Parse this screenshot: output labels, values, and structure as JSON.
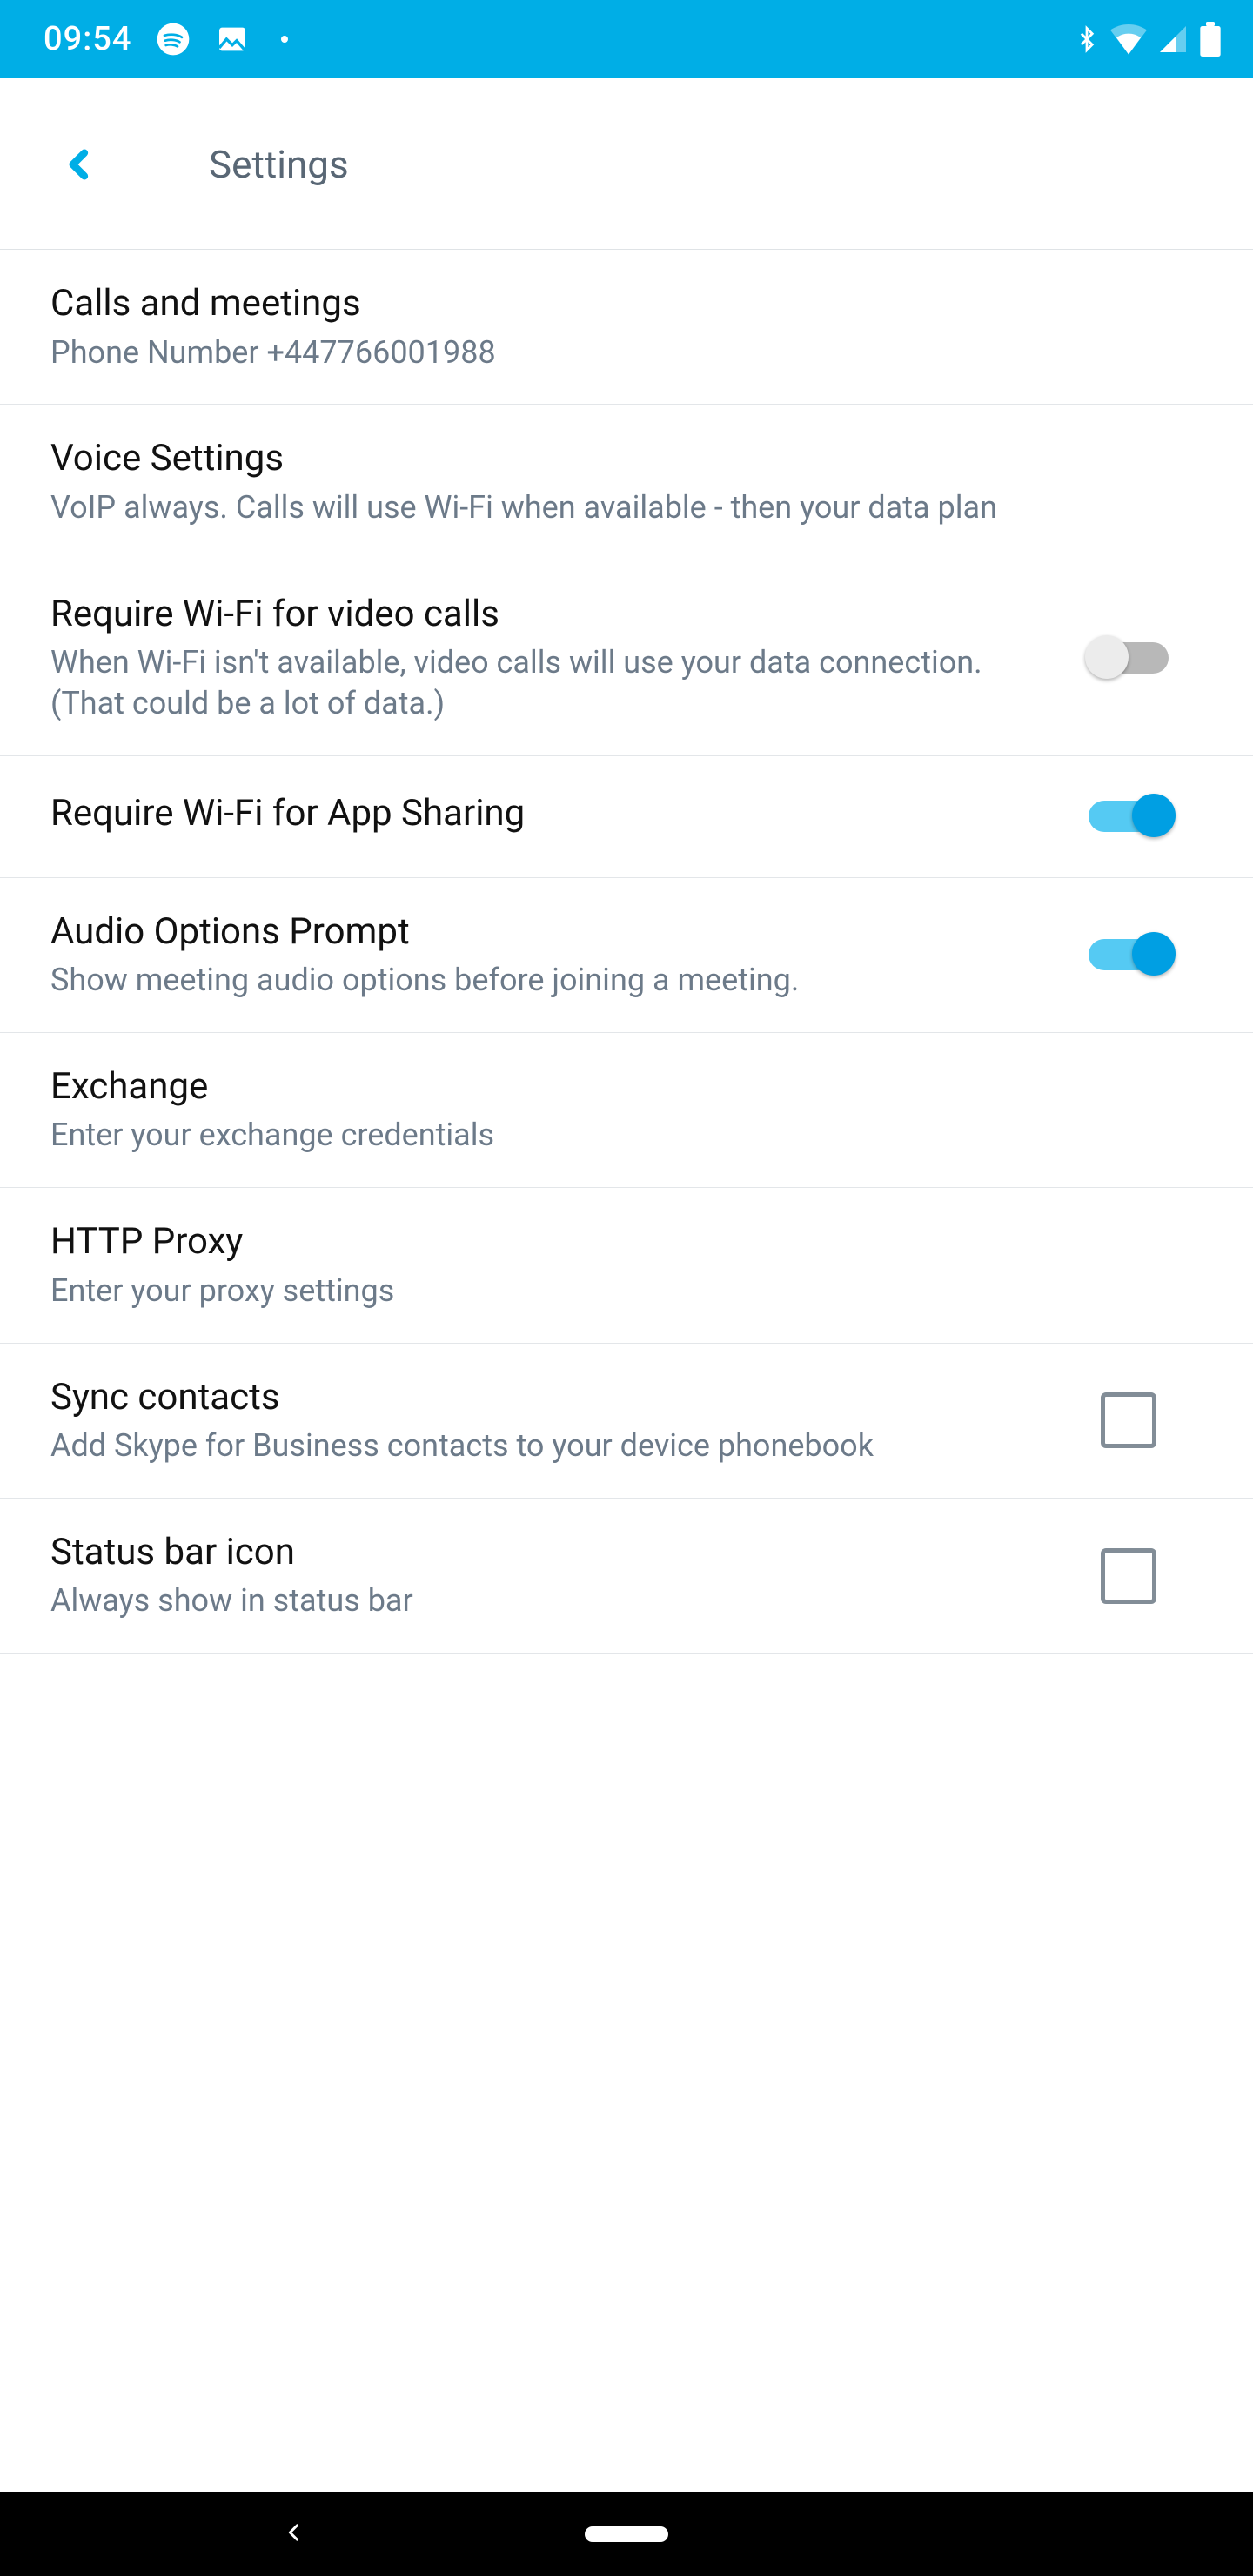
{
  "status": {
    "time": "09:54",
    "icons_left": [
      "spotify-icon",
      "image-icon",
      "dot-icon"
    ],
    "icons_right": [
      "bluetooth-icon",
      "wifi-icon",
      "cell-icon",
      "battery-icon"
    ]
  },
  "header": {
    "title": "Settings"
  },
  "items": [
    {
      "title": "Calls and meetings",
      "subtitle": "Phone Number +447766001988",
      "control": "none"
    },
    {
      "title": "Voice Settings",
      "subtitle": "VoIP always. Calls will use Wi-Fi when available - then your data plan",
      "control": "none"
    },
    {
      "title": "Require Wi-Fi for video calls",
      "subtitle": "When Wi-Fi isn't available, video calls will use your data connection. (That could be a lot of data.)",
      "control": "switch",
      "on": false
    },
    {
      "title": "Require Wi-Fi for App Sharing",
      "subtitle": "",
      "control": "switch",
      "on": true
    },
    {
      "title": "Audio Options Prompt",
      "subtitle": "Show meeting audio options before joining a meeting.",
      "control": "switch",
      "on": true
    },
    {
      "title": "Exchange",
      "subtitle": "Enter your exchange credentials",
      "control": "none"
    },
    {
      "title": "HTTP Proxy",
      "subtitle": "Enter your proxy settings",
      "control": "none"
    },
    {
      "title": "Sync contacts",
      "subtitle": "Add Skype for Business contacts to your device phonebook",
      "control": "checkbox",
      "checked": false
    },
    {
      "title": "Status bar icon",
      "subtitle": "Always show in status bar",
      "control": "checkbox",
      "checked": false
    }
  ],
  "colors": {
    "accent": "#00aee6",
    "switch_on_knob": "#009fe3",
    "switch_on_track": "#55caf3",
    "subtitle": "#6c7a89"
  }
}
